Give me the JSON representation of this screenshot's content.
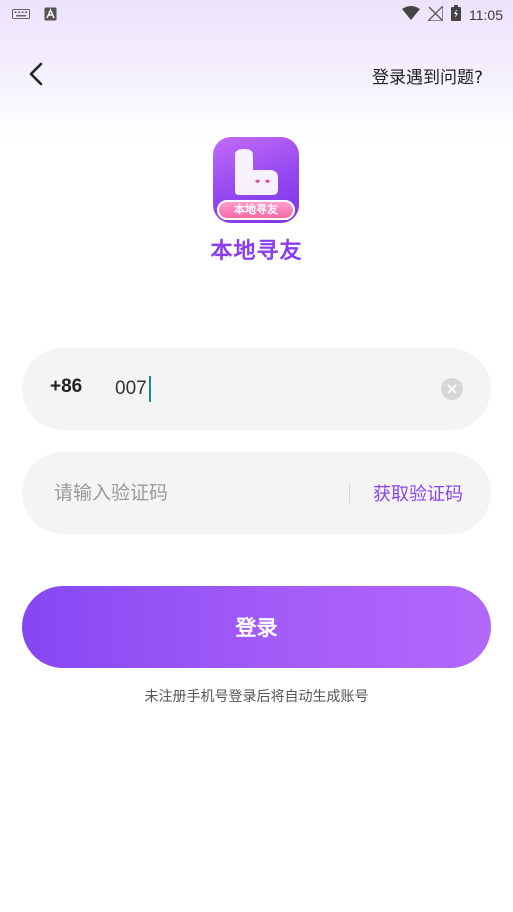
{
  "status_bar": {
    "time": "11:05",
    "left_icons": [
      "keyboard-icon",
      "text-a-icon"
    ],
    "right_icons": [
      "wifi-icon",
      "signal-off-icon",
      "battery-charging-icon"
    ]
  },
  "header": {
    "back_icon": "chevron-left-icon",
    "help_link": "登录遇到问题?"
  },
  "brand": {
    "logo_badge_text": "本地寻友",
    "app_name": "本地寻友"
  },
  "phone_field": {
    "country_code": "+86",
    "value": "007",
    "clear_icon": "clear-icon"
  },
  "code_field": {
    "placeholder": "请输入验证码",
    "value": "",
    "get_code_label": "获取验证码"
  },
  "login": {
    "button_label": "登录",
    "hint": "未注册手机号登录后将自动生成账号"
  },
  "colors": {
    "accent": "#8a46ee",
    "button_start": "#8547f3",
    "button_end": "#b468fb",
    "field_bg": "#f4f4f4"
  }
}
